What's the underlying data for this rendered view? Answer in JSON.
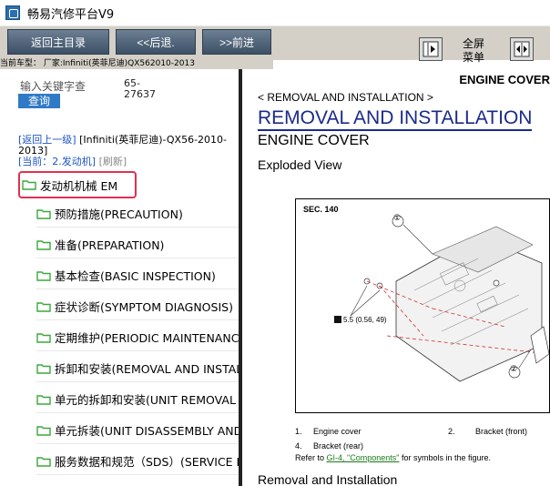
{
  "window": {
    "title": "畅易汽修平台V9"
  },
  "toolbar": {
    "home_label": "返回主目录",
    "back_label": "<<后退.",
    "forward_label": ">>前进",
    "fullscreen_label_1": "全屏",
    "fullscreen_label_2": "菜单",
    "subtitle": "当前车型： 厂家:Infiniti(英菲尼迪)QX562010-2013"
  },
  "search": {
    "placeholder": "输入关键字查",
    "button_label": "查询",
    "code_line1": "65-",
    "code_line2": "27637"
  },
  "nav": {
    "back_link": "[返回上一级]",
    "model_text": "[Infiniti(英菲尼迪)-QX56-2010-2013]",
    "current": "[当前：2.发动机]",
    "refresh": "[刷新]"
  },
  "tree": {
    "root": "发动机机械 EM",
    "children": [
      "预防措施(PRECAUTION)",
      "准备(PREPARATION)",
      "基本检查(BASIC INSPECTION)",
      "症状诊断(SYMPTOM DIAGNOSIS)",
      "定期维护(PERIODIC MAINTENANCE)",
      "拆卸和安装(REMOVAL AND INSTALLATION)",
      "单元的拆卸和安装(UNIT REMOVAL AND INSTALLATION)",
      "单元拆装(UNIT DISASSEMBLY AND ASSEMBLY)",
      "服务数据和规范（SDS）(SERVICE DATA AND SPECIFICATIONS)"
    ]
  },
  "doc": {
    "header": "ENGINE COVER",
    "breadcrumb": "< REMOVAL AND INSTALLATION >",
    "h1": "REMOVAL AND INSTALLATION",
    "h2": "ENGINE COVER",
    "h3": "Exploded View",
    "figure": {
      "sec": "SEC. 140",
      "callout1": "①",
      "callout2": "②",
      "torque": "5.5 (0.56, 49)"
    },
    "legend": [
      {
        "num": "1.",
        "text": "Engine cover"
      },
      {
        "num": "2.",
        "text": "Bracket (front)"
      },
      {
        "num": "4.",
        "text": "Bracket (rear)"
      }
    ],
    "refer_prefix": "Refer to ",
    "refer_link": "GI-4, \"Components\"",
    "refer_suffix": " for symbols in the figure.",
    "h4": "Removal and Installation"
  },
  "colors": {
    "toolbar_bg": "#d4d0c8",
    "button_bg": "#4a5d72",
    "search_button": "#2f7ac6",
    "highlight_border": "#e03050",
    "doc_title": "#1a2a8a",
    "folder_green": "#3aa83a"
  },
  "icons": {
    "app": "app-logo-icon",
    "fullscreen_left": "arrow-right-box-icon",
    "fullscreen_right": "split-arrows-icon",
    "folder": "folder-icon"
  }
}
